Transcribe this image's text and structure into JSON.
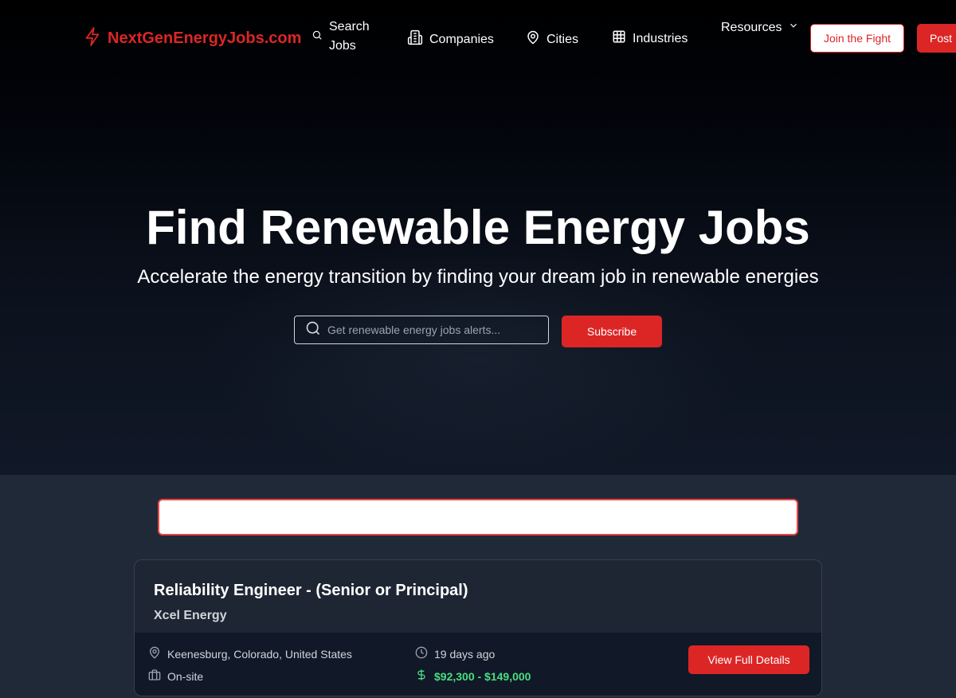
{
  "brand": {
    "name": "NextGenEnergyJobs.com",
    "accent": "#dc2626"
  },
  "nav": {
    "search_jobs": "Search Jobs",
    "companies": "Companies",
    "cities": "Cities",
    "industries": "Industries",
    "resources": "Resources",
    "join": "Join the Fight",
    "post": "Post"
  },
  "hero": {
    "title": "Find Renewable Energy Jobs",
    "subtitle": "Accelerate the energy transition by finding your dream job in renewable energies",
    "alert_placeholder": "Get renewable energy jobs alerts...",
    "subscribe": "Subscribe"
  },
  "search": {
    "value": ""
  },
  "job": {
    "title": "Reliability Engineer - (Senior or Principal)",
    "company": "Xcel Energy",
    "location": "Keenesburg, Colorado, United States",
    "work_type": "On-site",
    "posted": "19 days ago",
    "salary": "$92,300 - $149,000",
    "view_details": "View Full Details"
  },
  "colors": {
    "salary": "#4ade80",
    "page_bg": "#1f2937",
    "card_foot": "#111827"
  },
  "icons": [
    "bolt-icon",
    "search-icon",
    "building-icon",
    "map-pin-icon",
    "grid-icon",
    "chevron-down-icon",
    "clock-icon",
    "briefcase-icon",
    "dollar-icon"
  ]
}
